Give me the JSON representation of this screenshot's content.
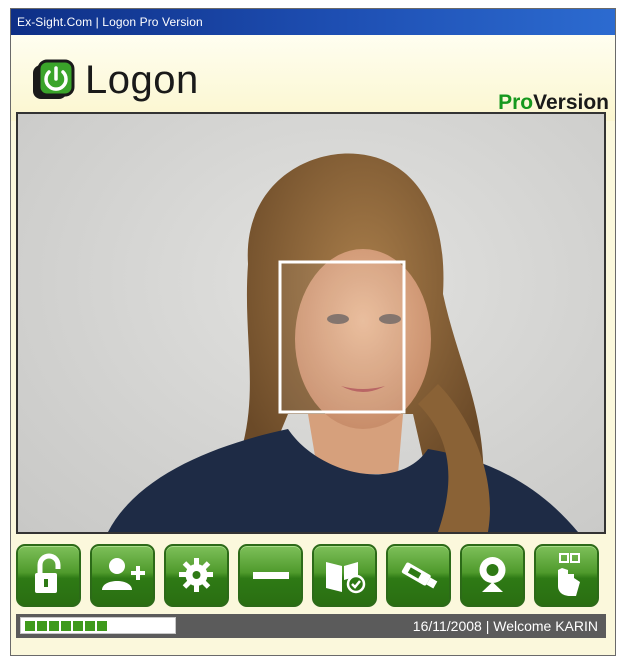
{
  "window": {
    "title": "Ex-Sight.Com | Logon Pro Version"
  },
  "header": {
    "logo_text": "Logon",
    "pro_label": "Pro",
    "version_label": "Version",
    "logo_icon": "power-icon"
  },
  "camera": {
    "face_detected": true
  },
  "toolbar": {
    "buttons": [
      {
        "name": "unlock-button",
        "icon": "unlock-icon"
      },
      {
        "name": "add-user-button",
        "icon": "add-user-icon"
      },
      {
        "name": "settings-button",
        "icon": "gear-icon"
      },
      {
        "name": "minimize-button",
        "icon": "minus-icon"
      },
      {
        "name": "help-button",
        "icon": "book-check-icon"
      },
      {
        "name": "usb-key-button",
        "icon": "usb-drive-icon"
      },
      {
        "name": "webcam-button",
        "icon": "webcam-icon"
      },
      {
        "name": "touch-screen-button",
        "icon": "touch-hand-icon"
      }
    ]
  },
  "status": {
    "progress_segments_filled": 7,
    "text": "16/11/2008 | Welcome KARIN"
  },
  "colors": {
    "titlebar": "#1e4fb3",
    "button_green": "#4f9a2c",
    "pro_green": "#16981e",
    "statusbar": "#5b5b5b"
  }
}
